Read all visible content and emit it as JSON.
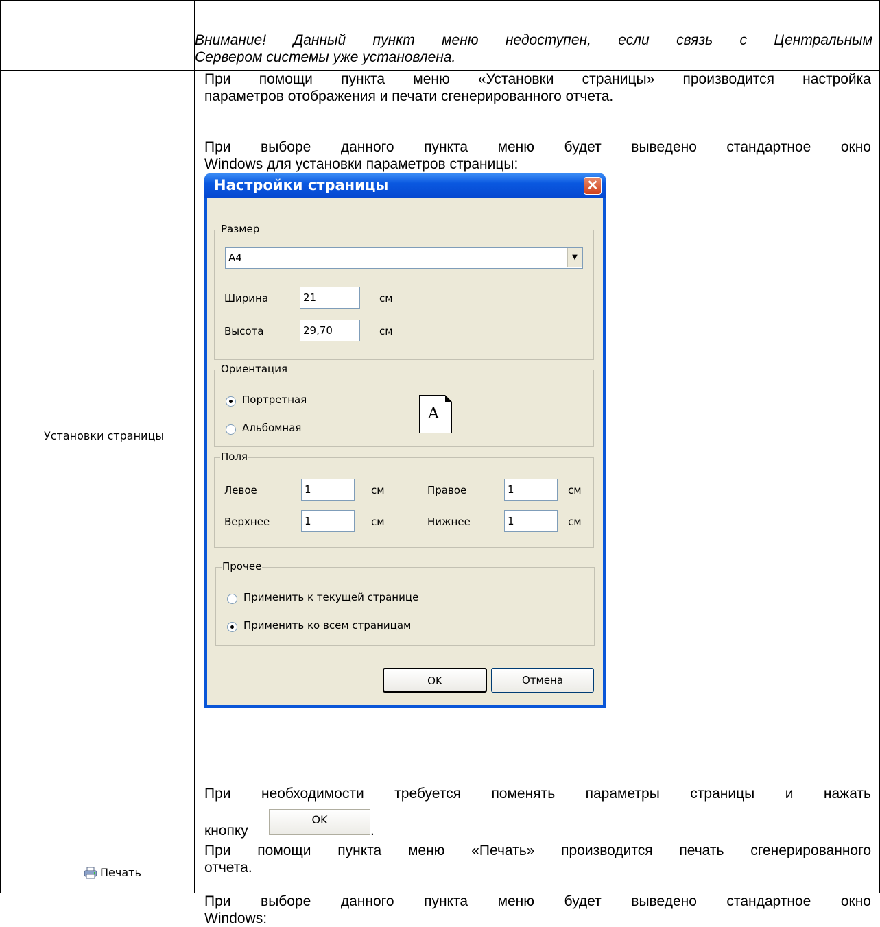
{
  "warning": {
    "line1": "Внимание! Данный пункт меню недоступен, если связь с Центральным",
    "line2": "Сервером системы уже установлена."
  },
  "row_page_setup": {
    "label": "Установки страницы",
    "para1_line1": "При помощи пункта меню «Установки страницы» производится настройка",
    "para1_line2": "параметров отображения и печати сгенерированного отчета.",
    "para2_line1": "При выборе данного пункта меню будет выведено стандартное окно",
    "para2_line2": "Windows для установки параметров страницы:",
    "para3_line1": "При необходимости требуется поменять параметры страницы и нажать",
    "para3_line2_prefix": "кнопку",
    "para3_line2_suffix": ".",
    "inline_button": "OK"
  },
  "dialog": {
    "title": "Настройки страницы",
    "close": "✕",
    "size_group": "Размер",
    "paper": "A4",
    "width_label": "Ширина",
    "width_value": "21",
    "height_label": "Высота",
    "height_value": "29,70",
    "unit": "см",
    "orientation_group": "Ориентация",
    "portrait": "Портретная",
    "landscape": "Альбомная",
    "page_icon_letter": "A",
    "margins_group": "Поля",
    "left_label": "Левое",
    "left_value": "1",
    "right_label": "Правое",
    "right_value": "1",
    "top_label": "Верхнее",
    "top_value": "1",
    "bottom_label": "Нижнее",
    "bottom_value": "1",
    "other_group": "Прочее",
    "apply_current": "Применить к текущей странице",
    "apply_all": "Применить ко всем страницам",
    "ok": "OK",
    "cancel": "Отмена"
  },
  "row_print": {
    "label": "Печать",
    "para1_line1": "При помощи пункта меню «Печать» производится печать сгенерированного",
    "para1_line2": "отчета.",
    "para2_line1": "При выборе данного пункта меню будет выведено стандартное окно",
    "para2_line2": "Windows:"
  }
}
